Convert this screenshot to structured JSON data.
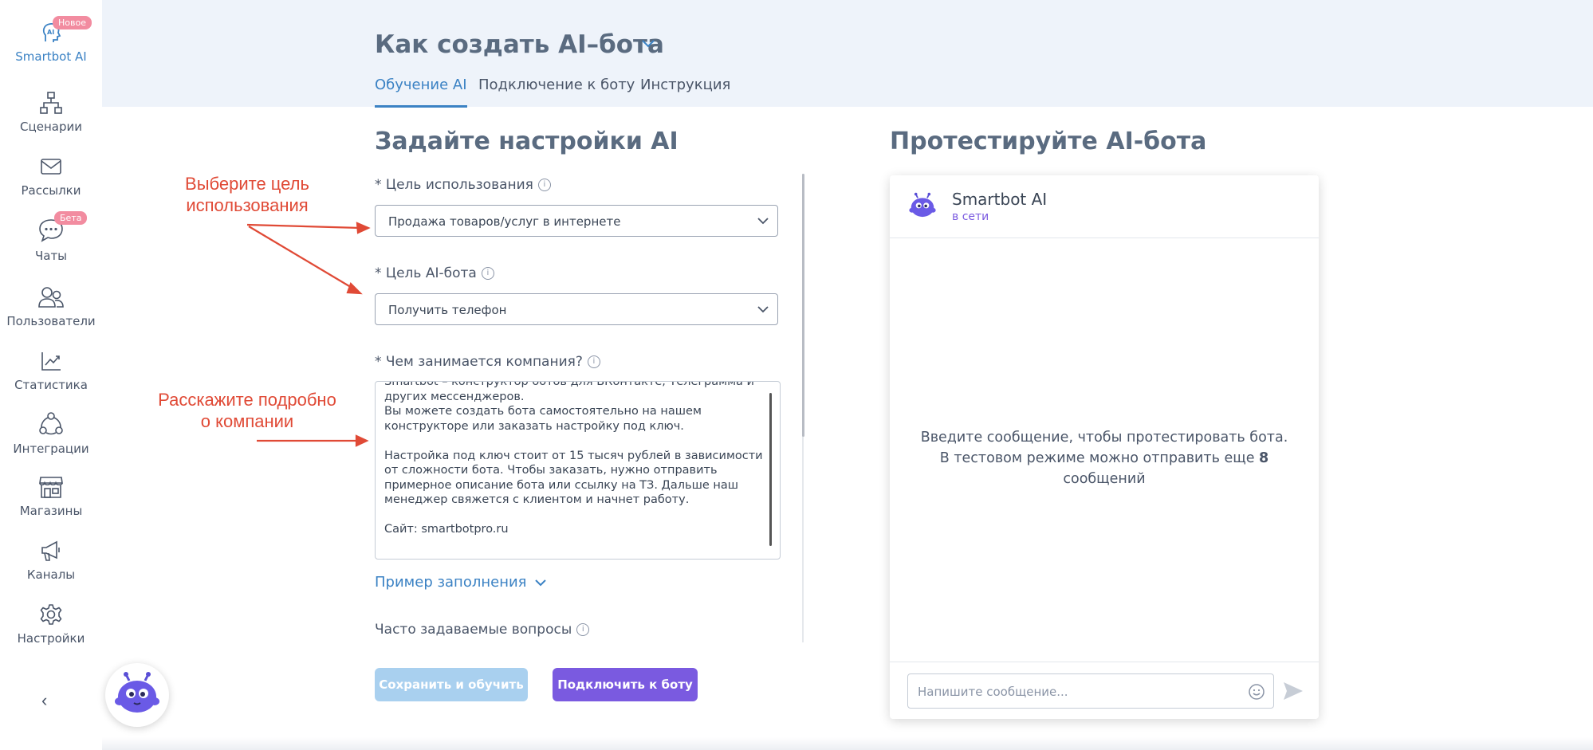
{
  "sidebar": {
    "items": [
      {
        "label": "Smartbot AI",
        "icon": "ai-head-icon",
        "badge": "Новое",
        "active": true
      },
      {
        "label": "Сценарии",
        "icon": "scenarios-icon"
      },
      {
        "label": "Рассылки",
        "icon": "mail-icon"
      },
      {
        "label": "Чаты",
        "icon": "chat-icon",
        "badge": "Бета"
      },
      {
        "label": "Пользователи",
        "icon": "users-icon"
      },
      {
        "label": "Статистика",
        "icon": "stats-icon"
      },
      {
        "label": "Интеграции",
        "icon": "integrations-icon"
      },
      {
        "label": "Магазины",
        "icon": "store-icon"
      },
      {
        "label": "Каналы",
        "icon": "megaphone-icon"
      },
      {
        "label": "Настройки",
        "icon": "gear-icon"
      }
    ],
    "collapse_icon": "‹"
  },
  "header": {
    "title": "Как создать AI–бота",
    "tabs": [
      {
        "label": "Обучение AI",
        "active": true
      },
      {
        "label": "Подключение к боту"
      },
      {
        "label": "Инструкция"
      }
    ]
  },
  "settings": {
    "title": "Задайте настройки AI",
    "purpose": {
      "label": "* Цель использования",
      "value": "Продажа товаров/услуг в интернете"
    },
    "goal": {
      "label": "* Цель AI-бота",
      "value": "Получить телефон"
    },
    "company": {
      "label": "* Чем занимается компания?",
      "text": "Smartbot – конструктор ботов для ВКонтакте, Телеграмма и других мессенджеров.\nВы можете создать бота самостоятельно на нашем конструкторе или заказать настройку под ключ.\n\nНастройка под ключ стоит от 15 тысяч рублей в зависимости от сложности бота. Чтобы заказать, нужно отправить примерное описание бота или ссылку на ТЗ. Дальше наш менеджер свяжется с клиентом и начнет работу.\n\nСайт: smartbotpro.ru"
    },
    "example_link": "Пример заполнения",
    "faq_label": "Часто задаваемые вопросы",
    "save_button": "Сохранить и обучить",
    "connect_button": "Подключить к боту"
  },
  "annotations": {
    "choose_goal_line1": "Выберите цель",
    "choose_goal_line2": "использования",
    "describe_line1": "Расскажите подробно",
    "describe_line2": "о компании"
  },
  "test": {
    "title": "Протестируйте AI-бота",
    "bot_name": "Smartbot AI",
    "bot_status": "в сети",
    "empty_line1": "Введите сообщение, чтобы протестировать бота.",
    "empty_line2_prefix": "В тестовом режиме можно отправить еще ",
    "remaining": "8",
    "empty_line3": "сообщений",
    "input_placeholder": "Напишите сообщение..."
  },
  "colors": {
    "accent": "#3b82c4",
    "primary_button": "#7a5ae0",
    "disabled_button": "#a9d0ef",
    "annotation": "#e04a36",
    "badge": "#f28ca0"
  }
}
